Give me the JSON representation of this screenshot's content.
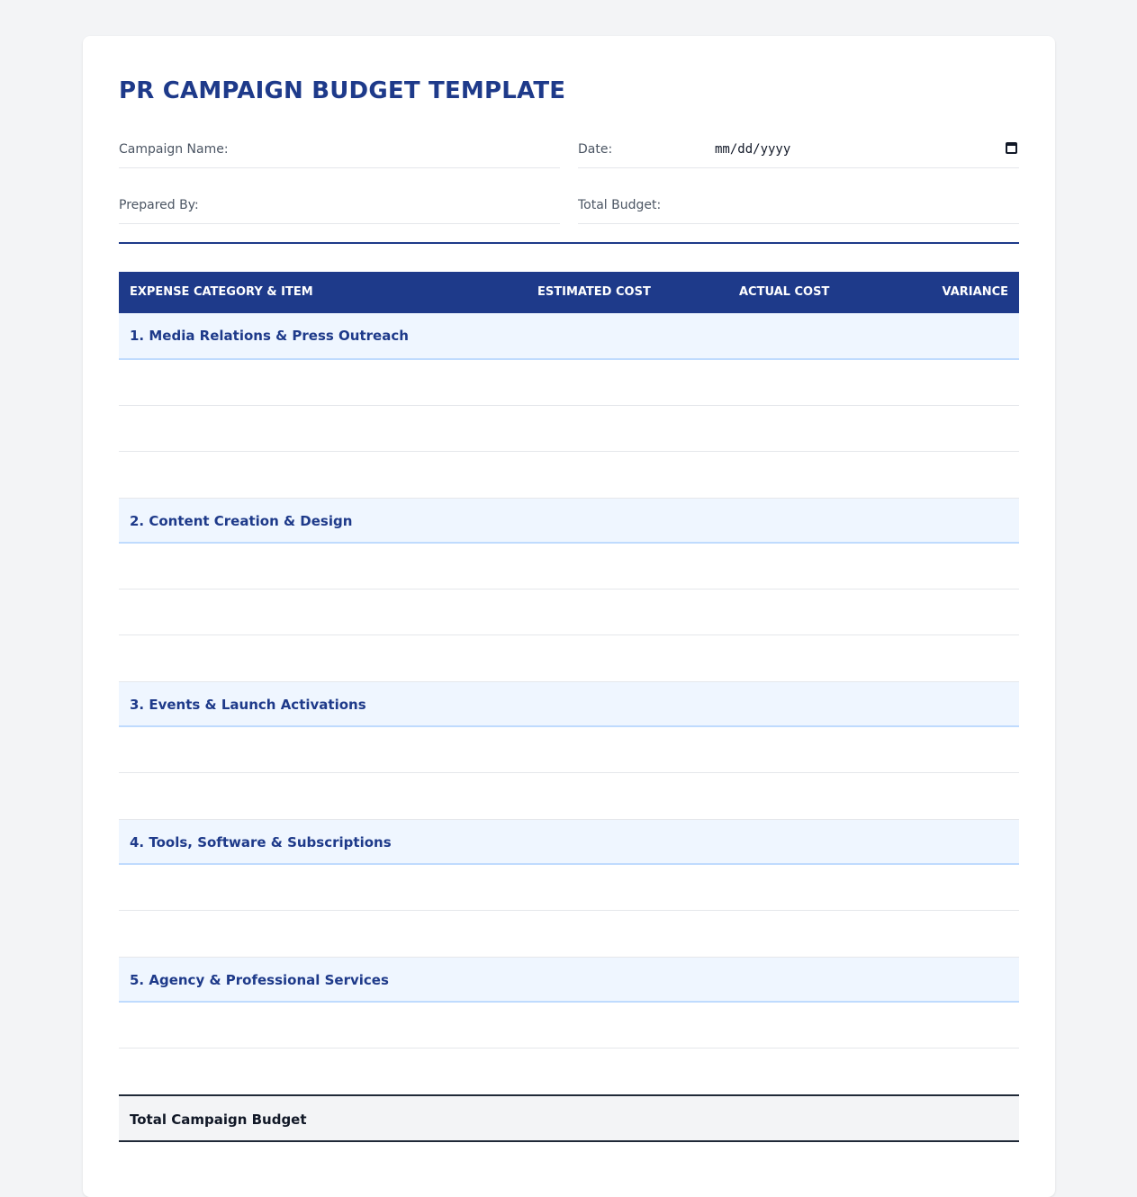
{
  "title": "PR CAMPAIGN BUDGET TEMPLATE",
  "meta": {
    "campaign_name_label": "Campaign Name:",
    "campaign_name_value": "",
    "date_label": "Date:",
    "date_value": "mm/dd/yyyy",
    "prepared_by_label": "Prepared By:",
    "prepared_by_value": "",
    "total_budget_label": "Total Budget:",
    "total_budget_value": ""
  },
  "table": {
    "headers": [
      "EXPENSE CATEGORY & ITEM",
      "ESTIMATED COST",
      "ACTUAL COST",
      "VARIANCE"
    ],
    "categories": [
      {
        "label": "1. Media Relations & Press Outreach"
      },
      {
        "label": "2. Content Creation & Design"
      },
      {
        "label": "3. Events & Launch Activations"
      },
      {
        "label": "4. Tools, Software & Subscriptions"
      },
      {
        "label": "5. Agency & Professional Services"
      }
    ],
    "total_label": "Total Campaign Budget"
  },
  "icons": {
    "date_picker": "calendar-icon"
  },
  "colors": {
    "primary": "#1e3a8a",
    "category_bg": "#eff6ff",
    "page_bg": "#f3f4f6"
  }
}
